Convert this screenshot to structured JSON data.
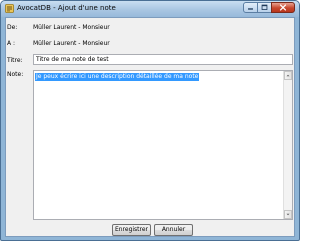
{
  "window": {
    "title": "AvocatDB - Ajout d'une note"
  },
  "form": {
    "de": {
      "label": "De:",
      "value": "Müller Laurent - Monsieur"
    },
    "a": {
      "label": "A :",
      "value": "Müller Laurent - Monsieur"
    },
    "titre": {
      "label": "Titre:",
      "value": "Titre de ma note de test"
    },
    "note": {
      "label": "Note:",
      "value": "Je peux écrire ici une description détaillée de ma note"
    }
  },
  "buttons": {
    "save": "Enregistrer",
    "cancel": "Annuler"
  },
  "colors": {
    "selection": "#3399ff",
    "close_button": "#c7472d",
    "frame": "#8fb5d6"
  },
  "icons": {
    "app": "app-form-icon",
    "minimize": "minimize-icon",
    "maximize": "maximize-icon",
    "close": "close-icon"
  }
}
